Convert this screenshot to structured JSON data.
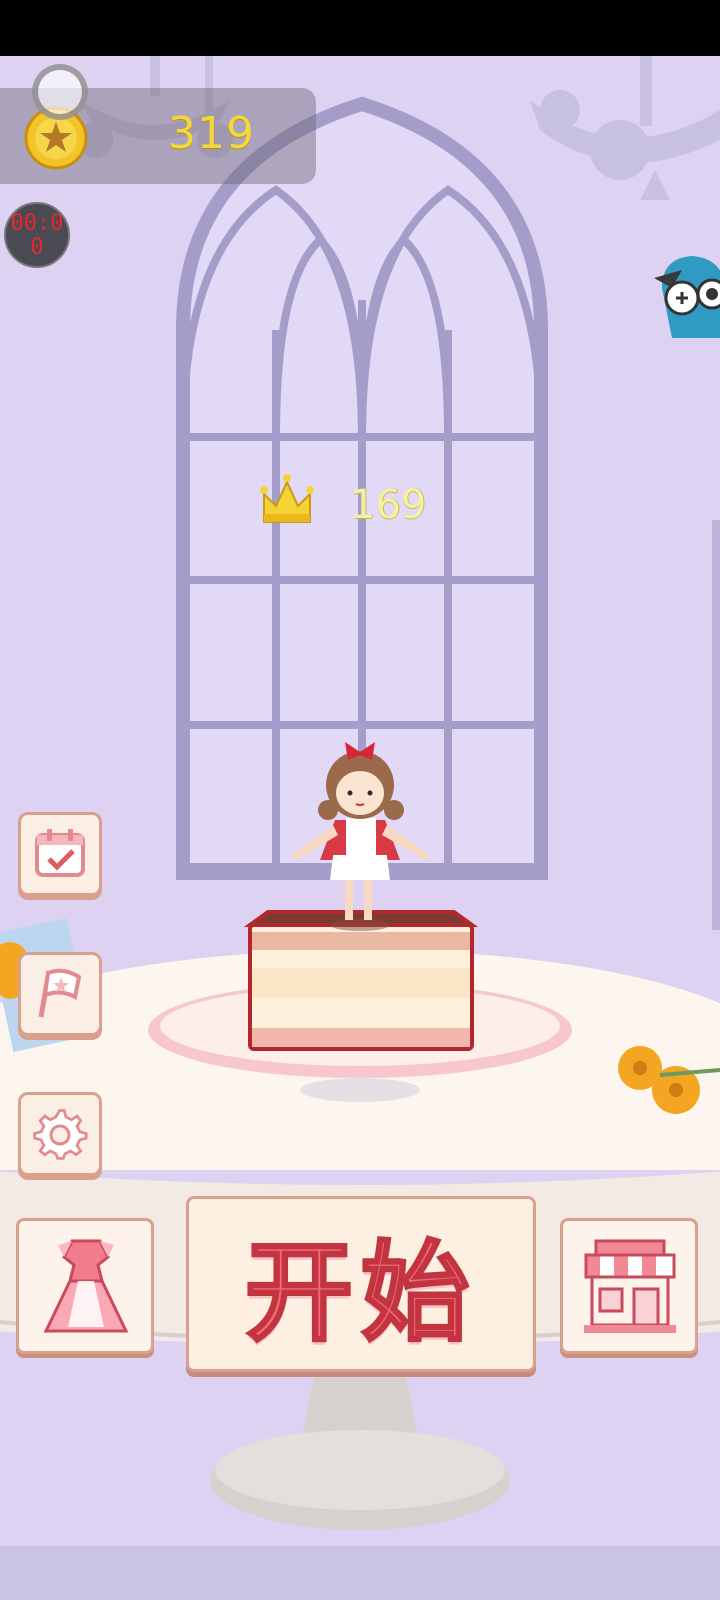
{
  "hud": {
    "coins": "319",
    "timer": "00:00",
    "best_score": "169"
  },
  "start_button": {
    "label": "开始"
  },
  "icons": {
    "coin": "coin-star-icon",
    "crown": "crown-icon",
    "timer": "timer-badge",
    "owl": "owl-mascot-icon",
    "calendar": "calendar-check-icon",
    "flag": "flag-icon",
    "settings": "gear-icon",
    "wardrobe": "dress-icon",
    "shop": "shop-icon"
  },
  "colors": {
    "background": "#ddd2f2",
    "coin_text": "#f3d83a",
    "start_text": "#f26a78",
    "button_border": "#d9a08e"
  }
}
